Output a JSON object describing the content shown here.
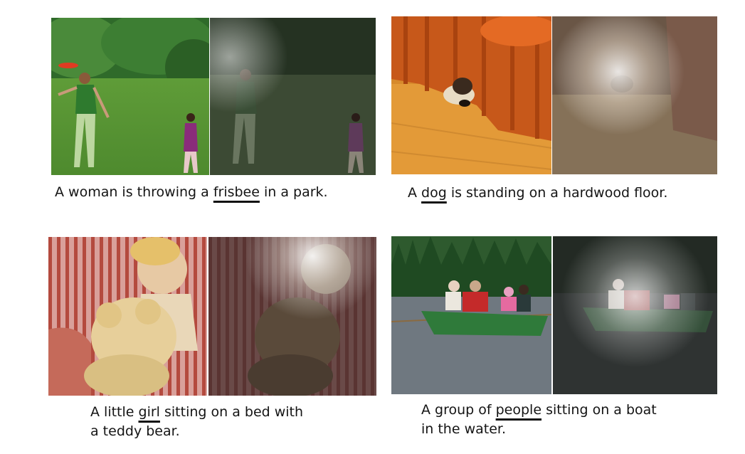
{
  "figure": {
    "examples": [
      {
        "caption_before": "A woman is throwing a ",
        "word": "frisbee",
        "caption_after": " in a park.",
        "caption_line2": ""
      },
      {
        "caption_before": "A ",
        "word": "dog",
        "caption_after": " is standing on a hardwood floor.",
        "caption_line2": ""
      },
      {
        "caption_before": "A little ",
        "word": "girl",
        "caption_after": " sitting on a bed with",
        "caption_line2": "a teddy bear."
      },
      {
        "caption_before": "A group of ",
        "word": "people",
        "caption_after": " sitting on a boat",
        "caption_line2": "in the water."
      }
    ]
  }
}
